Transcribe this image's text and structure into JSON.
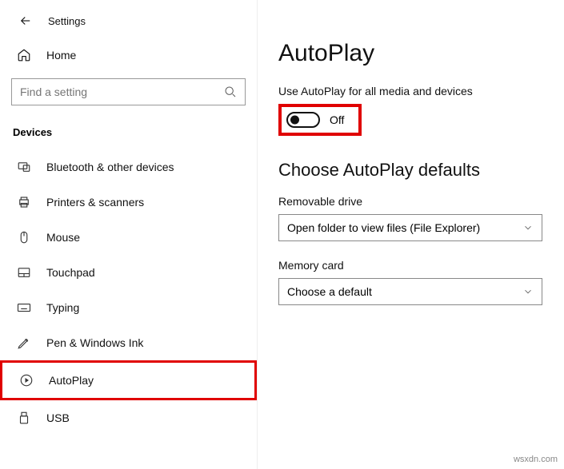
{
  "header": {
    "title": "Settings"
  },
  "home": {
    "label": "Home"
  },
  "search": {
    "placeholder": "Find a setting"
  },
  "section": {
    "title": "Devices"
  },
  "nav": [
    {
      "label": "Bluetooth & other devices"
    },
    {
      "label": "Printers & scanners"
    },
    {
      "label": "Mouse"
    },
    {
      "label": "Touchpad"
    },
    {
      "label": "Typing"
    },
    {
      "label": "Pen & Windows Ink"
    },
    {
      "label": "AutoPlay"
    },
    {
      "label": "USB"
    }
  ],
  "page": {
    "title": "AutoPlay",
    "toggle_label": "Use AutoPlay for all media and devices",
    "toggle_state": "Off",
    "defaults_heading": "Choose AutoPlay defaults",
    "removable_label": "Removable drive",
    "removable_value": "Open folder to view files (File Explorer)",
    "memory_label": "Memory card",
    "memory_value": "Choose a default"
  },
  "watermark": "wsxdn.com"
}
